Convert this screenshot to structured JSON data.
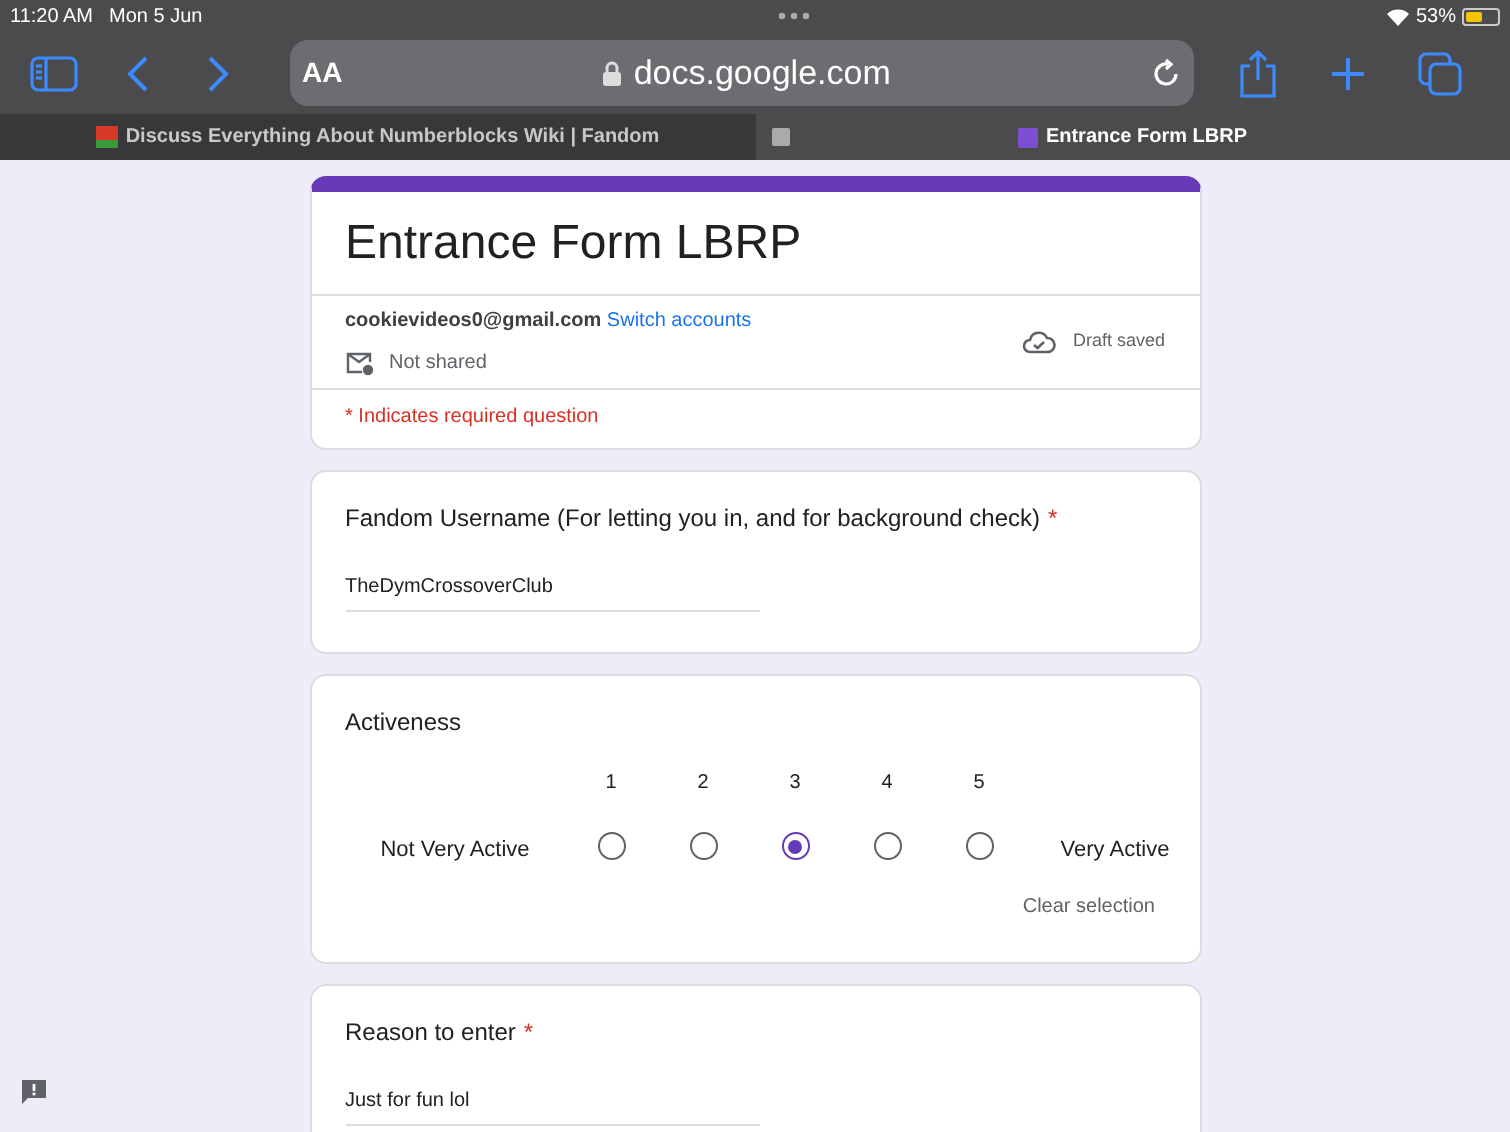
{
  "status_bar": {
    "time": "11:20 AM",
    "date": "Mon 5 Jun",
    "battery": "53%"
  },
  "toolbar": {
    "text_size": "AA",
    "url": "docs.google.com"
  },
  "tabs": [
    {
      "title": "Discuss Everything About Numberblocks Wiki | Fandom",
      "selected": false
    },
    {
      "title": "Entrance Form LBRP",
      "selected": true
    }
  ],
  "form": {
    "title": "Entrance Form LBRP",
    "account": "cookievideos0@gmail.com",
    "switch_link": "Switch accounts",
    "sharing": "Not shared",
    "draft_status": "Draft saved",
    "required_note": "* Indicates required question"
  },
  "questions": [
    {
      "kind": "text",
      "label": "Fandom Username (For letting you in, and for background check)",
      "required_mark": "*",
      "value": "TheDymCrossoverClub"
    },
    {
      "kind": "scale",
      "label": "Activeness",
      "low_label": "Not Very Active",
      "high_label": "Very Active",
      "clear": "Clear selection",
      "options": [
        {
          "label": "1",
          "selected": false
        },
        {
          "label": "2",
          "selected": false
        },
        {
          "label": "3",
          "selected": true
        },
        {
          "label": "4",
          "selected": false
        },
        {
          "label": "5",
          "selected": false
        }
      ]
    },
    {
      "kind": "text",
      "label": "Reason to enter",
      "required_mark": "*",
      "value": "Just for fun lol"
    }
  ]
}
